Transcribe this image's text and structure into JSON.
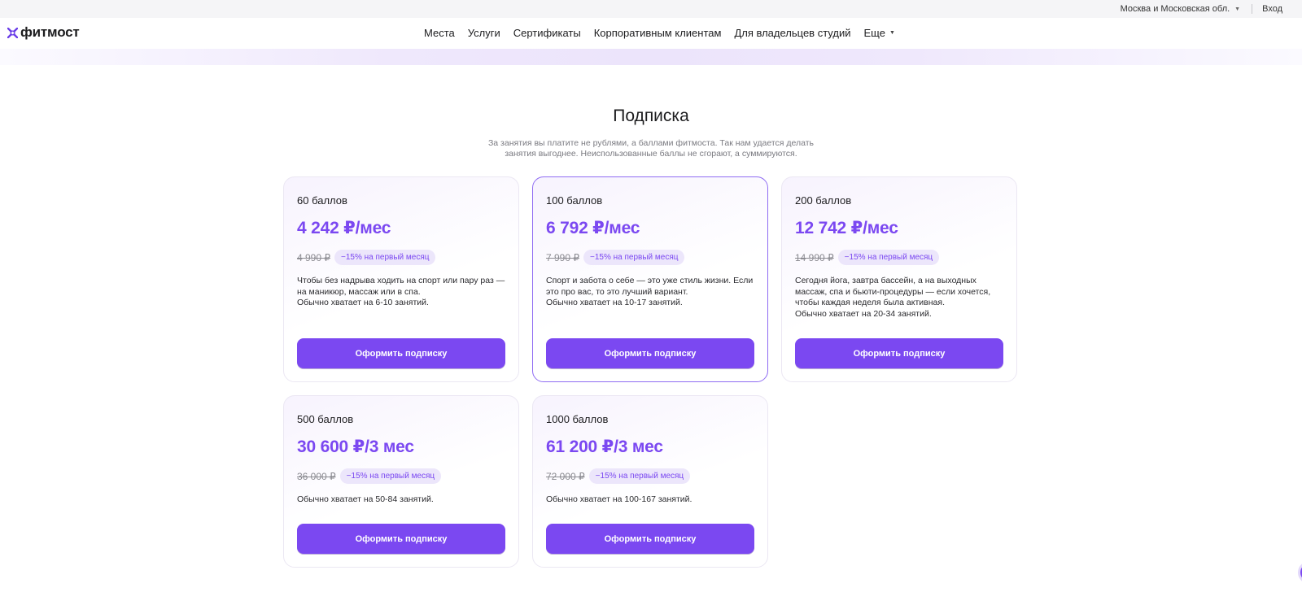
{
  "topbar": {
    "region": "Москва и Московская обл.",
    "login": "Вход"
  },
  "brand": {
    "name": "фитмост",
    "accent": "#7b48f1"
  },
  "nav": {
    "items": [
      "Места",
      "Услуги",
      "Сертификаты",
      "Корпоративным клиентам",
      "Для владельцев студий"
    ],
    "more": "Еще"
  },
  "page": {
    "title": "Подписка",
    "subtitle": "За занятия вы платите не рублями, а баллами фитмоста. Так нам удается делать занятия выгоднее. Неиспользованные баллы не сгорают, а суммируются."
  },
  "plans": [
    {
      "points": "60 баллов",
      "price": "4 242 ₽/мес",
      "old_price": "4 990 ₽",
      "discount": "−15% на первый месяц",
      "description": "Чтобы без надрыва ходить на спорт или пару раз — на маникюр, массаж или в спа.\nОбычно хватает на 6-10 занятий.",
      "button": "Оформить подписку"
    },
    {
      "points": "100 баллов",
      "price": "6 792 ₽/мес",
      "old_price": "7 990 ₽",
      "discount": "−15% на первый месяц",
      "description": "Спорт и забота о себе — это уже стиль жизни. Если это про вас, то это лучший вариант.\nОбычно хватает на 10-17 занятий.",
      "button": "Оформить подписку"
    },
    {
      "points": "200 баллов",
      "price": "12 742 ₽/мес",
      "old_price": "14 990 ₽",
      "discount": "−15% на первый месяц",
      "description": "Сегодня йога, завтра бассейн, а на выходных массаж, спа и бьюти-процедуры — если хочется, чтобы каждая неделя была активная.\nОбычно хватает на 20-34 занятий.",
      "button": "Оформить подписку"
    },
    {
      "points": "500 баллов",
      "price": "30 600 ₽/3 мес",
      "old_price": "36 000 ₽",
      "discount": "−15% на первый месяц",
      "description": "Обычно хватает на 50-84 занятий.",
      "button": "Оформить подписку"
    },
    {
      "points": "1000 баллов",
      "price": "61 200 ₽/3 мес",
      "old_price": "72 000 ₽",
      "discount": "−15% на первый месяц",
      "description": "Обычно хватает на 100-167 занятий.",
      "button": "Оформить подписку"
    }
  ]
}
